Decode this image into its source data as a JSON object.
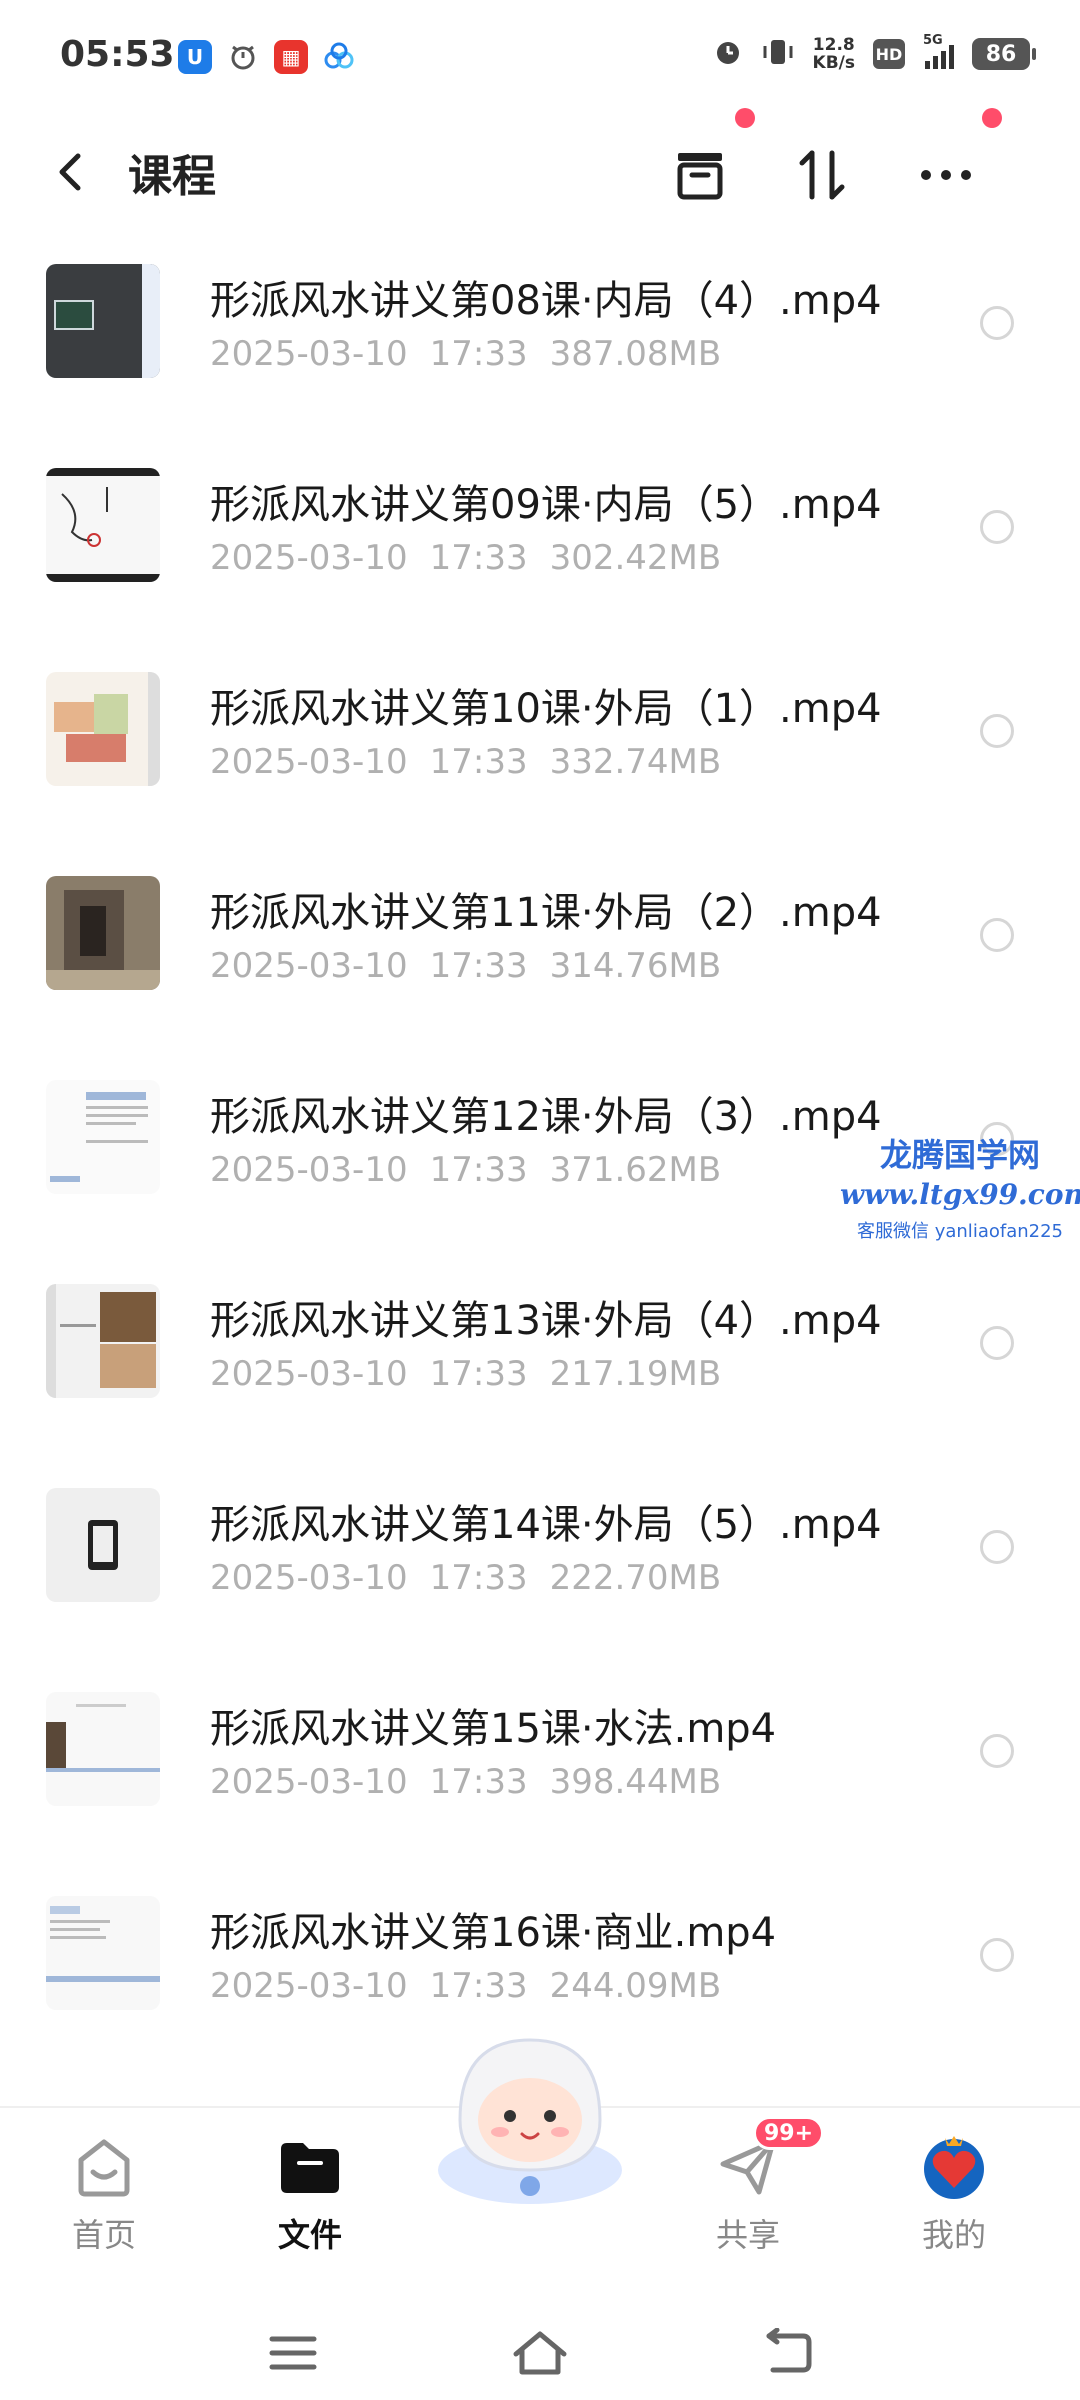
{
  "status_bar": {
    "time": "05:53",
    "net_speed_value": "12.8",
    "net_speed_unit": "KB/s",
    "hd": "HD",
    "network": "5G",
    "battery": "86"
  },
  "header": {
    "title": "课程",
    "icons": [
      "back-icon",
      "archive-icon",
      "sort-icon",
      "more-icon"
    ],
    "notification_color": "#ff4d6a"
  },
  "files": [
    {
      "name": "形派风水讲义第08课·内局（4）.mp4",
      "date": "2025-03-10",
      "time": "17:33",
      "size": "387.08MB"
    },
    {
      "name": "形派风水讲义第09课·内局（5）.mp4",
      "date": "2025-03-10",
      "time": "17:33",
      "size": "302.42MB"
    },
    {
      "name": "形派风水讲义第10课·外局（1）.mp4",
      "date": "2025-03-10",
      "time": "17:33",
      "size": "332.74MB"
    },
    {
      "name": "形派风水讲义第11课·外局（2）.mp4",
      "date": "2025-03-10",
      "time": "17:33",
      "size": "314.76MB"
    },
    {
      "name": "形派风水讲义第12课·外局（3）.mp4",
      "date": "2025-03-10",
      "time": "17:33",
      "size": "371.62MB"
    },
    {
      "name": "形派风水讲义第13课·外局（4）.mp4",
      "date": "2025-03-10",
      "time": "17:33",
      "size": "217.19MB"
    },
    {
      "name": "形派风水讲义第14课·外局（5）.mp4",
      "date": "2025-03-10",
      "time": "17:33",
      "size": "222.70MB"
    },
    {
      "name": "形派风水讲义第15课·水法.mp4",
      "date": "2025-03-10",
      "time": "17:33",
      "size": "398.44MB"
    },
    {
      "name": "形派风水讲义第16课·商业.mp4",
      "date": "2025-03-10",
      "time": "17:33",
      "size": "244.09MB"
    }
  ],
  "watermark": {
    "title": "龙腾国学网",
    "url": "www.ltgx99.com",
    "contact": "客服微信 yanliaofan225"
  },
  "bottom_nav": {
    "items": [
      {
        "label": "首页",
        "icon": "home-icon",
        "active": false
      },
      {
        "label": "文件",
        "icon": "folder-icon",
        "active": true
      },
      {
        "label": "共享",
        "icon": "share-plane-icon",
        "active": false,
        "badge": "99+"
      },
      {
        "label": "我的",
        "icon": "heart-avatar-icon",
        "active": false
      }
    ]
  },
  "system_nav": [
    "menu-icon",
    "home-outline-icon",
    "back-return-icon"
  ],
  "colors": {
    "accent": "#ff4d6a",
    "meta_text": "#b0b0b0",
    "watermark": "#2f6bd6"
  }
}
